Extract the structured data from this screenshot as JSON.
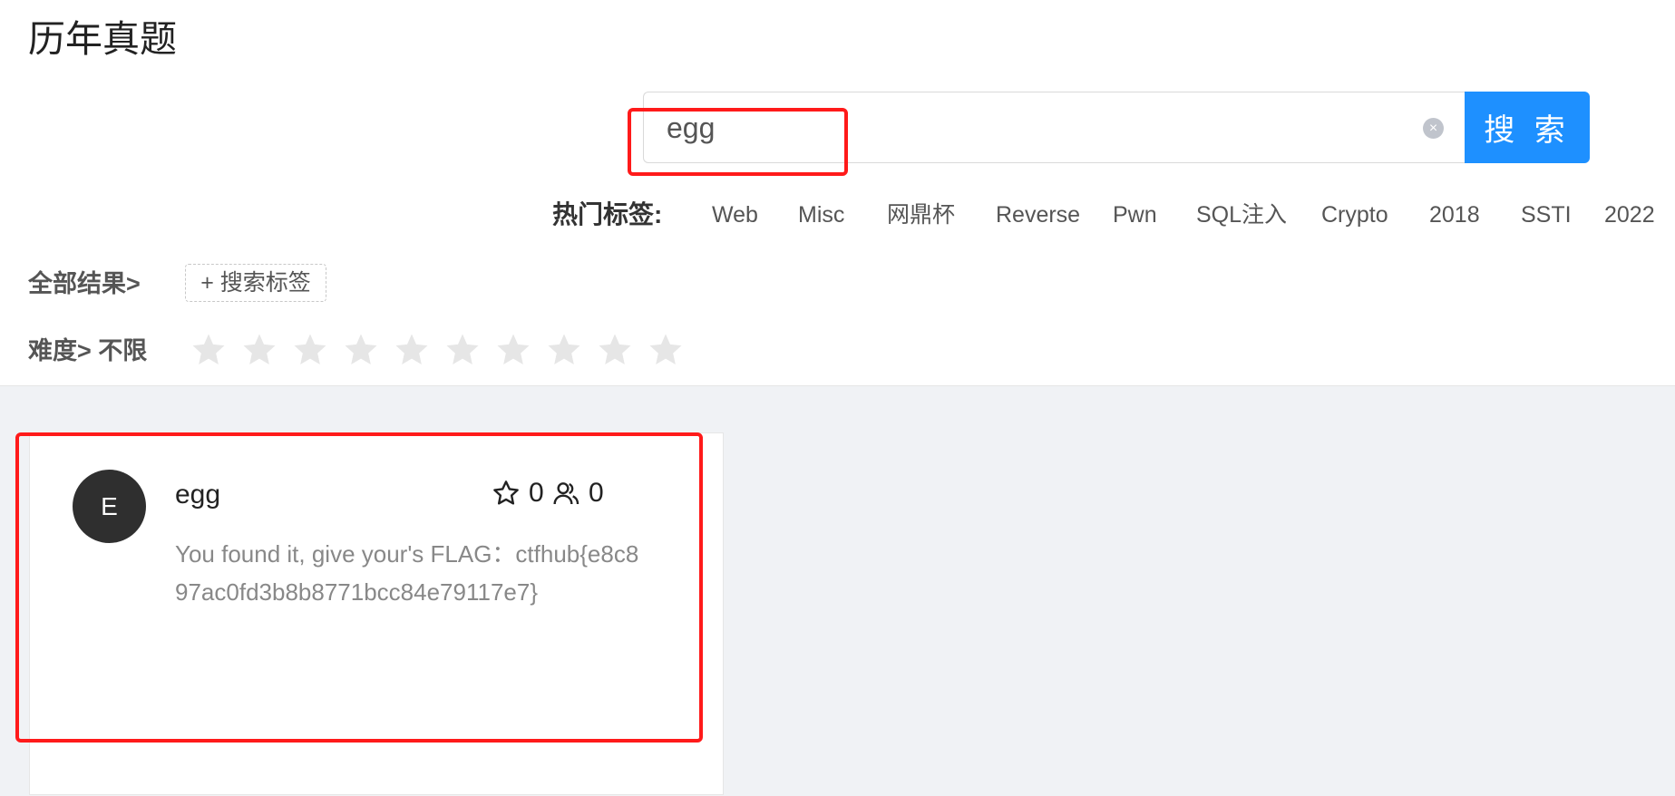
{
  "page": {
    "title": "历年真题"
  },
  "search": {
    "value": "egg",
    "clear_symbol": "×",
    "button_label": "搜 索"
  },
  "hot_tags": {
    "label": "热门标签:",
    "items": [
      "Web",
      "Misc",
      "网鼎杯",
      "Reverse",
      "Pwn",
      "SQL注入",
      "Crypto",
      "2018",
      "SSTI",
      "2022"
    ]
  },
  "filters": {
    "all_results_label": "全部结果>",
    "add_tag_label": "+ 搜索标签",
    "difficulty_label": "难度> 不限",
    "difficulty_max_stars": 10,
    "difficulty_selected": 0
  },
  "results": [
    {
      "avatar_letter": "E",
      "title": "egg",
      "stars": "0",
      "solvers": "0",
      "description": "You found it, give your's FLAG：ctfhub{e8c897ac0fd3b8b8771bcc84e79117e7}"
    }
  ],
  "colors": {
    "accent": "#1e90ff",
    "highlight": "#ff1a1a",
    "avatar_bg": "#2f2f2f",
    "star_empty": "#e6e6e6",
    "page_bg": "#f0f2f5"
  },
  "icons": {
    "clear": "close-circle-icon",
    "star": "star-icon",
    "favorite": "star-outline-icon",
    "users": "users-icon"
  }
}
